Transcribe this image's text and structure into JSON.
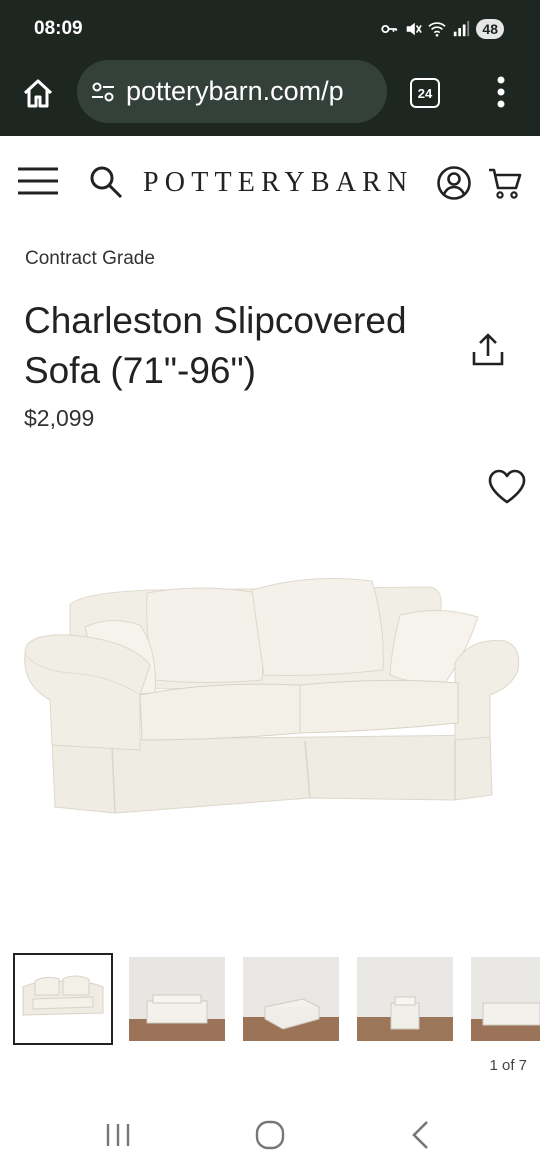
{
  "status_bar": {
    "time": "08:09",
    "battery": "48",
    "icons": [
      "vpn-key-icon",
      "vibrate-mute-icon",
      "wifi-icon",
      "signal-icon"
    ]
  },
  "browser": {
    "url": "potterybarn.com/p",
    "tab_count": "24",
    "icons": [
      "home-icon",
      "site-settings-icon",
      "more-vert-icon"
    ]
  },
  "site_header": {
    "logo": "POTTERYBARN",
    "icons": [
      "menu-icon",
      "search-icon",
      "account-icon",
      "cart-icon"
    ]
  },
  "product": {
    "eyebrow": "Contract Grade",
    "title": "Charleston Slipcovered Sofa (71\"-96\")",
    "price": "$2,099",
    "image_count": 7,
    "current_image": 1,
    "pager": "1 of 7"
  },
  "colors": {
    "chrome_bg": "#1d2620",
    "url_pill": "#34403a",
    "sofa_fabric": "#f2efe6",
    "text": "#222222"
  },
  "nav_bar": {
    "icons": [
      "recent-apps-icon",
      "home-circle-icon",
      "back-icon"
    ]
  }
}
